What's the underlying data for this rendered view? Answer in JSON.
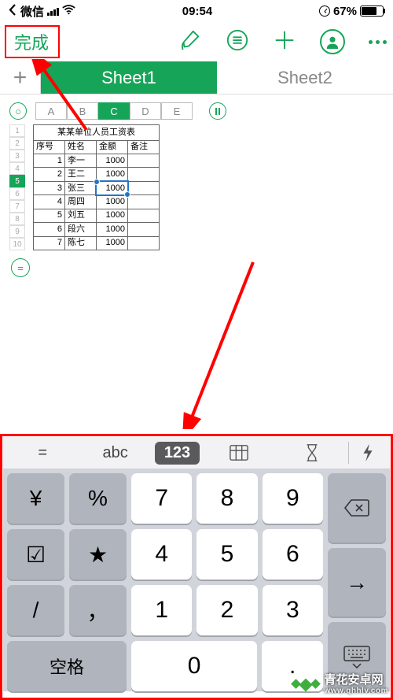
{
  "status": {
    "carrier": "微信",
    "time": "09:54",
    "battery": "67%"
  },
  "toolbar": {
    "done": "完成"
  },
  "tabs": {
    "sheet1": "Sheet1",
    "sheet2": "Sheet2"
  },
  "columns": {
    "A": "A",
    "B": "B",
    "C": "C",
    "D": "D",
    "E": "E"
  },
  "rowNums": [
    "1",
    "2",
    "3",
    "4",
    "5",
    "6",
    "7",
    "8",
    "9",
    "10"
  ],
  "table": {
    "title": "某某单位人员工资表",
    "headers": {
      "seq": "序号",
      "name": "姓名",
      "amount": "金额",
      "note": "备注"
    },
    "rows": [
      {
        "seq": "1",
        "name": "李一",
        "amount": "1000"
      },
      {
        "seq": "2",
        "name": "王二",
        "amount": "1000"
      },
      {
        "seq": "3",
        "name": "张三",
        "amount": "1000"
      },
      {
        "seq": "4",
        "name": "周四",
        "amount": "1000"
      },
      {
        "seq": "5",
        "name": "刘五",
        "amount": "1000"
      },
      {
        "seq": "6",
        "name": "段六",
        "amount": "1000"
      },
      {
        "seq": "7",
        "name": "陈七",
        "amount": "1000"
      }
    ]
  },
  "kbdBar": {
    "eq": "=",
    "abc": "abc",
    "num": "123"
  },
  "keys": {
    "yen": "¥",
    "pct": "%",
    "check": "☑",
    "star": "★",
    "slash": "/",
    "comma": "，",
    "k7": "7",
    "k8": "8",
    "k9": "9",
    "k4": "4",
    "k5": "5",
    "k6": "6",
    "k1": "1",
    "k2": "2",
    "k3": "3",
    "k0": "0",
    "dot": ".",
    "space": "空格",
    "arrow": "→"
  },
  "watermark": {
    "title": "青花安卓网",
    "url": "www.qhhlv.com"
  }
}
